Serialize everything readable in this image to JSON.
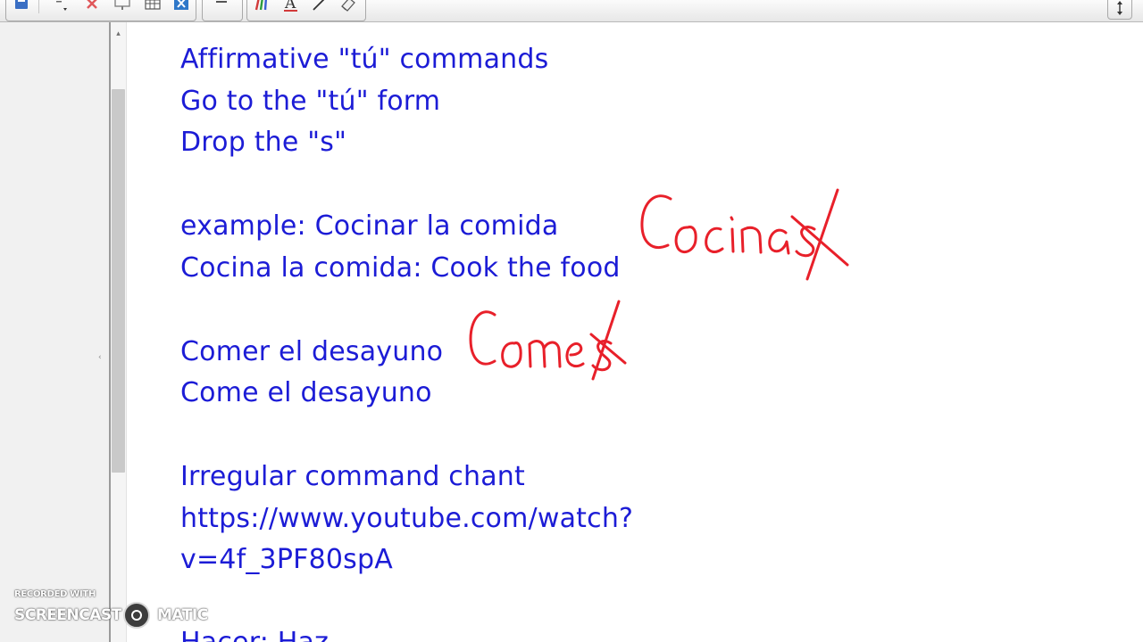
{
  "document": {
    "lines": [
      "Affirmative \"tú\" commands",
      "Go to the \"tú\" form",
      "Drop the \"s\"",
      "example:  Cocinar la comida",
      "Cocina la comida:  Cook the food",
      "Comer el desayuno",
      "Come el desayuno",
      "Irregular command chant",
      "https://www.youtube.com/watch?",
      "v=4f_3PF80spA",
      "Hacer: Haz"
    ],
    "text_color": "#1c1cd6"
  },
  "handwriting": {
    "annotation_1": "Cocinas",
    "annotation_2": "Comes",
    "ink_color": "#e8202a"
  },
  "toolbar": {
    "icons": [
      "save-icon",
      "undo-icon",
      "delete-icon",
      "screen-shade-icon",
      "table-icon",
      "close-doc-icon",
      "minimize-icon",
      "pens-icon",
      "text-icon",
      "line-icon",
      "eraser-icon",
      "scroll-arrows-icon"
    ]
  },
  "watermark": {
    "recorded_with": "RECORDED WITH",
    "brand_left": "SCREENCAST",
    "brand_right": "MATIC"
  }
}
